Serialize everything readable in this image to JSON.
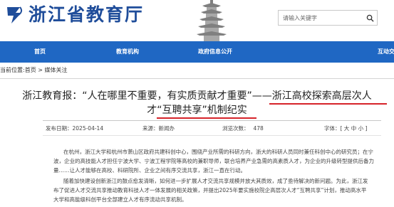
{
  "header": {
    "site_title": "浙江省教育厅",
    "search_placeholder": "请输入关键字"
  },
  "nav": {
    "items": [
      "首页",
      "教育机构",
      "政府信息公开",
      "互动交"
    ]
  },
  "breadcrumb": "当前位置:首页 > 媒体关注",
  "article": {
    "title_line1": "浙江教育报：“人在哪里不重要，有实质贡献才重要”——浙江高校探索高层次人",
    "title_line2": "才“互聘共享”机制纪实",
    "publish_date": "发布日期：2025-04-14",
    "source": "来源：新闻办",
    "views_label": "浏览次数：",
    "views": "478",
    "font_size": "字体：[ 大 中 小 ]",
    "paragraph1": [
      "在杭州，浙江大学和杭州市萧山区政府共建科创中心，围绕产业所需的科研方向，浙大的科研人员同时兼任科创中心的研究员；在宁",
      "波，企业的高技能人才担任宁波大学、宁波工程学院等高校的兼职导师，联合培养产业急需的高素质人才，为企业的升级转型提供后备力",
      "量……让人才能够在高校、科研院所、企业之间有序交流共享，浙江一直在行动。"
    ],
    "paragraph2": [
      "随着加快建设创新浙江的鼓点愈发清晰，如何进一步扩展人才交流共享规模并放大其质效，成了亟待解决的新问题。为此，浙江发",
      "布了促进人才交流共享推动教育科技人才一体发展的相关政策，并提出2025年要实施校院企高层次人才“互聘共享”计划，推动高水平",
      "大学和高能级科创平台全部建立人才有序流动共享机制。"
    ]
  },
  "colors": {
    "nav_background": "#1f67c3",
    "title_blue": "#1f4d9a",
    "underline_red": "#d6232a"
  },
  "icons": [
    "site-logo-icon",
    "pagoda-icon",
    "search-icon"
  ]
}
